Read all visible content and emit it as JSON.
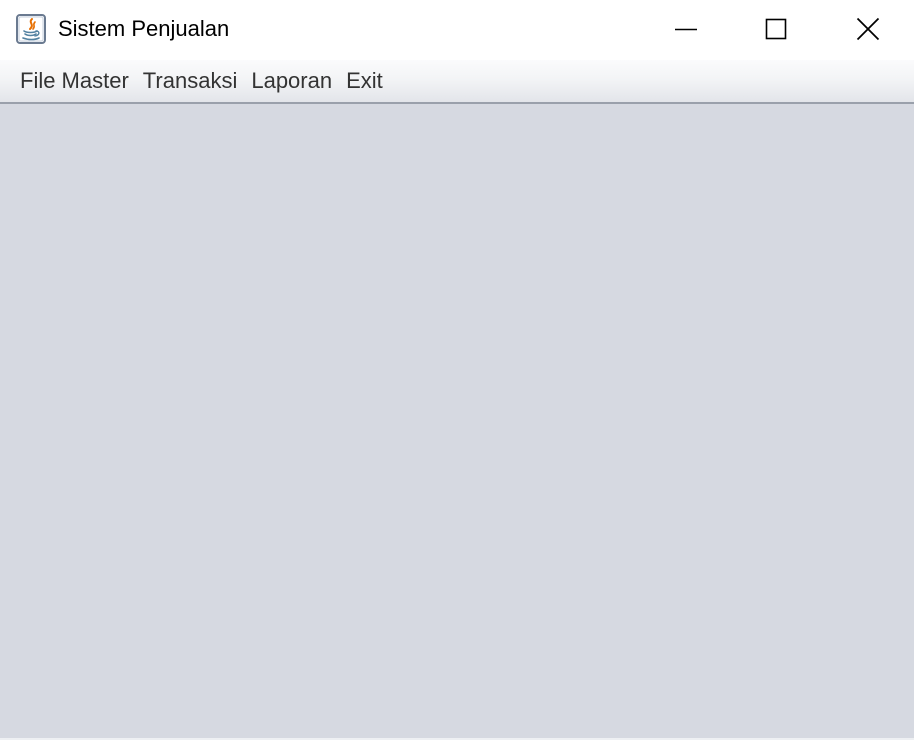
{
  "window": {
    "title": "Sistem Penjualan",
    "app_icon": "java-icon",
    "controls": {
      "minimize_icon": "minimize-icon",
      "maximize_icon": "maximize-icon",
      "close_icon": "close-icon"
    }
  },
  "menubar": {
    "items": [
      {
        "label": "File Master"
      },
      {
        "label": "Transaksi"
      },
      {
        "label": "Laporan"
      },
      {
        "label": "Exit"
      }
    ]
  },
  "colors": {
    "content_background": "#d6d9e1",
    "menubar_border": "#9aa0ab",
    "java_icon_accent": "#e76f00",
    "java_icon_blue": "#5382a1"
  }
}
